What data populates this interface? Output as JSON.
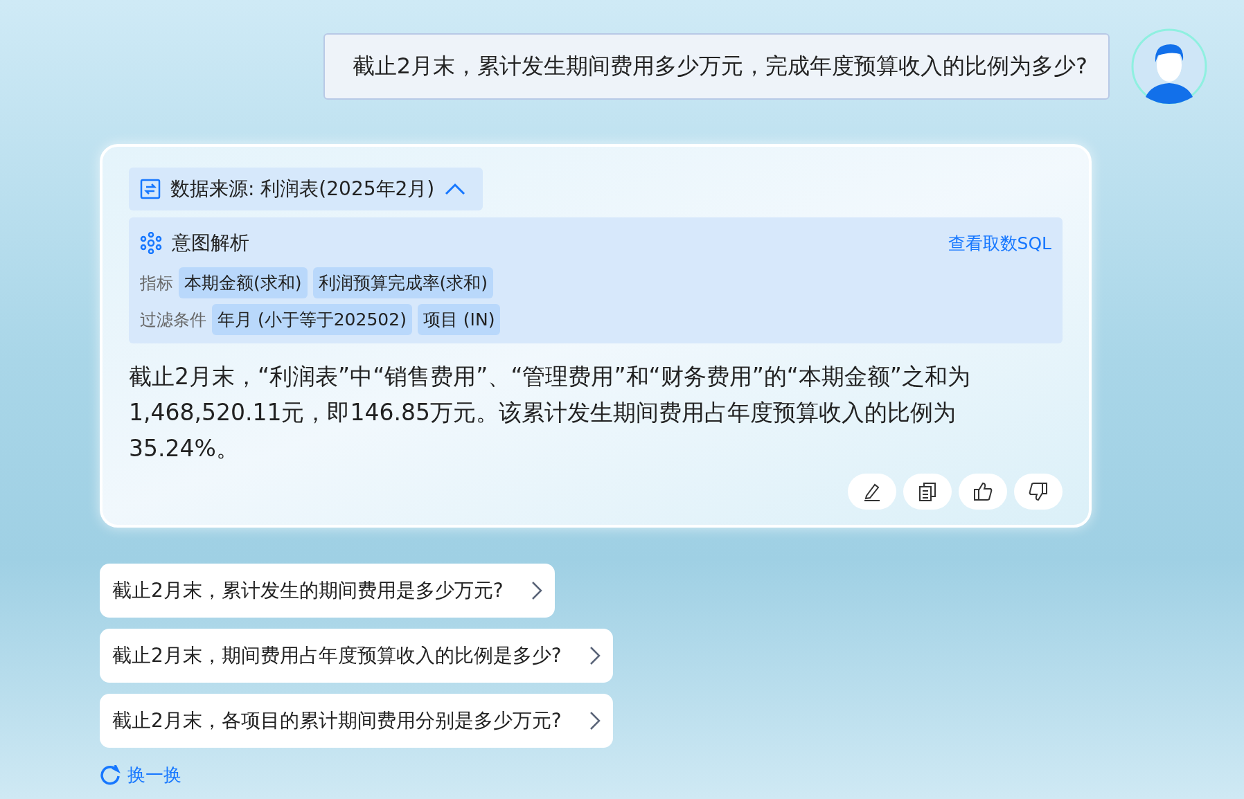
{
  "user_message": {
    "text": "截止2月末，累计发生期间费用多少万元，完成年度预算收入的比例为多少?"
  },
  "answer": {
    "source": {
      "label": "数据来源: 利润表(2025年2月)",
      "expanded": true
    },
    "intent": {
      "title": "意图解析",
      "sql_link": "查看取数SQL",
      "rows": [
        {
          "label": "指标",
          "tags": [
            "本期金额(求和)",
            "利润预算完成率(求和)"
          ]
        },
        {
          "label": "过滤条件",
          "tags": [
            "年月 (小于等于202502)",
            "项目 (IN)"
          ]
        }
      ]
    },
    "text": "截止2月末，“利润表”中“销售费用”、“管理费用”和“财务费用”的“本期金额”之和为1,468,520.11元，即146.85万元。该累计发生期间费用占年度预算收入的比例为35.24%。"
  },
  "suggestions": [
    "截止2月末，累计发生的期间费用是多少万元?",
    "截止2月末，期间费用占年度预算收入的比例是多少?",
    "截止2月末，各项目的累计期间费用分别是多少万元?"
  ],
  "refresh": "换一换"
}
